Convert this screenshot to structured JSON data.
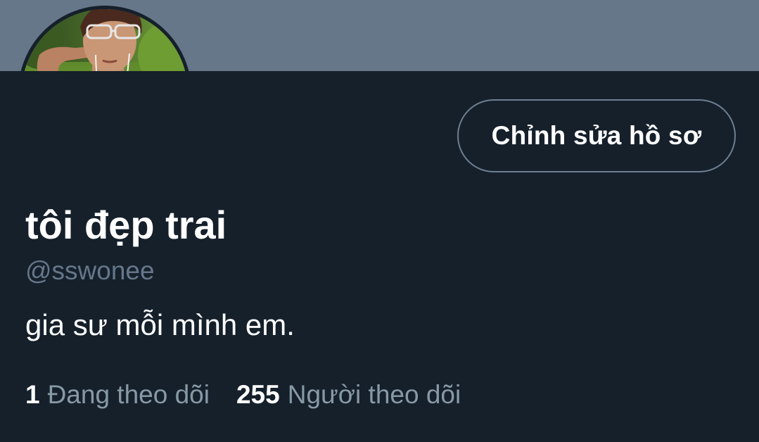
{
  "profile": {
    "display_name": "tôi đẹp trai",
    "handle": "@sswonee",
    "bio": "gia sư mỗi mình em.",
    "edit_button_label": "Chỉnh sửa hồ sơ",
    "avatar_icon": "profile-photo"
  },
  "stats": {
    "following_count": "1",
    "following_label": "Đang theo dõi",
    "followers_count": "255",
    "followers_label": "Người theo dõi"
  },
  "colors": {
    "background": "#15202b",
    "banner": "#66778a",
    "secondary_text": "#8899a6",
    "primary_text": "#ffffff"
  }
}
